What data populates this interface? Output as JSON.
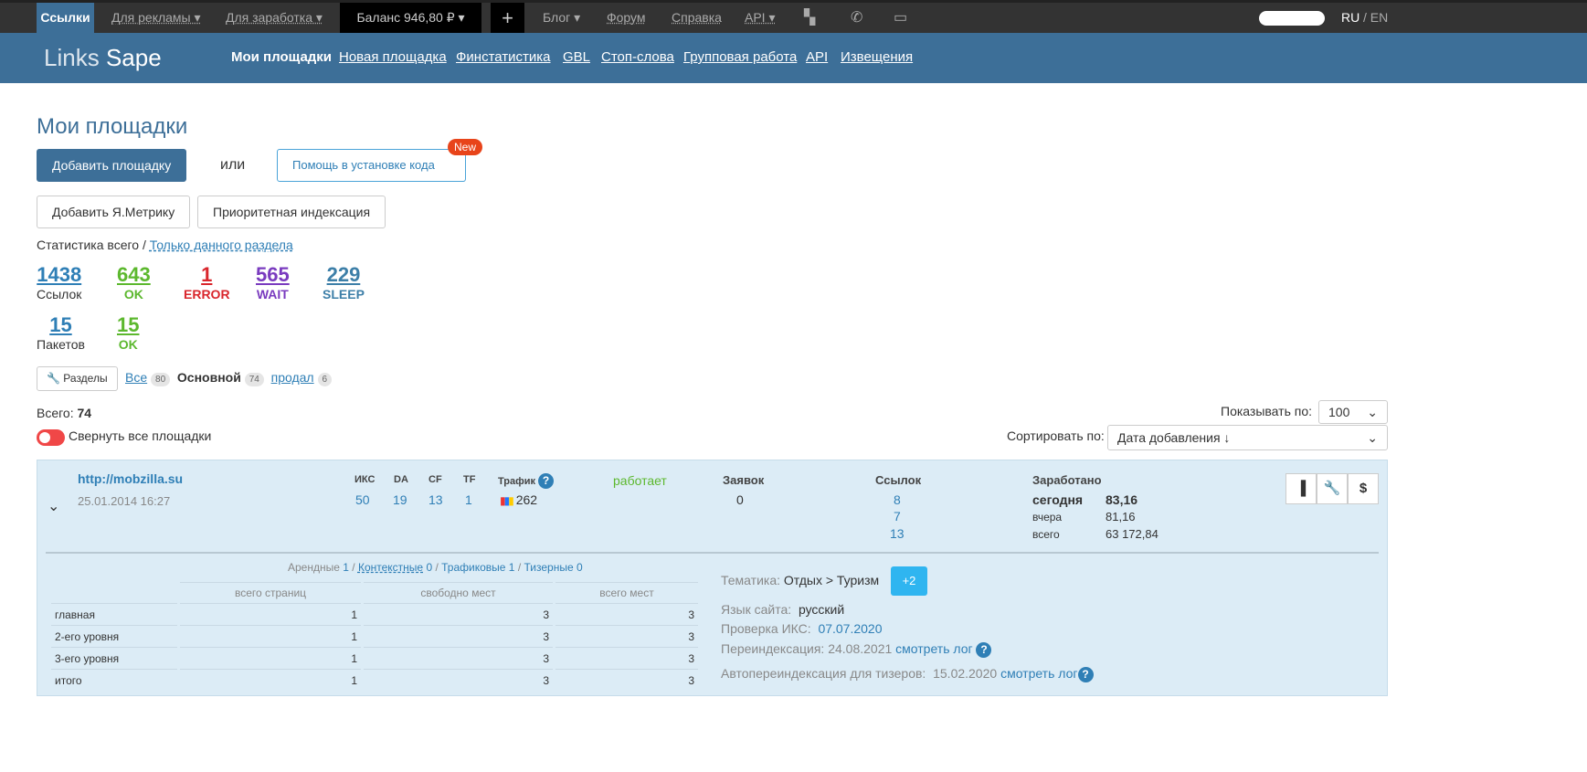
{
  "topbar": {
    "links": "Ссылки",
    "ads": "Для рекламы ▾",
    "earn": "Для заработка ▾",
    "balance": "Баланс 946,80 ₽ ▾",
    "plus": "+",
    "blog": "Блог ▾",
    "forum": "Форум",
    "help": "Справка",
    "api": "API ▾",
    "lang_ru": "RU",
    "lang_en": "/ EN"
  },
  "header": {
    "logo_a": "Links",
    "logo_b": "Sape",
    "nav": [
      "Мои площадки",
      "Новая площадка",
      "Финстатистика",
      "GBL",
      "Стоп-слова",
      "Групповая работа",
      "API",
      "Извещения"
    ]
  },
  "page": {
    "title": "Мои площадки",
    "add": "Добавить площадку",
    "or": "или",
    "help_install": "Помощь в установке кода",
    "new": "New",
    "metrika": "Добавить Я.Метрику",
    "priority": "Приоритетная индексация",
    "stat_all": "Статистика всего /",
    "stat_section": "Только данного раздела"
  },
  "stats": [
    {
      "n": "1438",
      "l": "Ссылок",
      "c": "#2f7fb6"
    },
    {
      "n": "643",
      "l": "OK",
      "c": "#5cb82e"
    },
    {
      "n": "1",
      "l": "ERROR",
      "c": "#d9262c"
    },
    {
      "n": "565",
      "l": "WAIT",
      "c": "#7a3bbf"
    },
    {
      "n": "229",
      "l": "SLEEP",
      "c": "#3d7fa8"
    },
    {
      "n": "15",
      "l": "Пакетов",
      "c": "#2f7fb6"
    },
    {
      "n": "15",
      "l": "OK",
      "c": "#5cb82e"
    }
  ],
  "filters": {
    "sections": "Разделы",
    "all": "Все",
    "all_n": "80",
    "main": "Основной",
    "main_n": "74",
    "sold": "продал",
    "sold_n": "6"
  },
  "list": {
    "total_label": "Всего:",
    "total": "74",
    "collapse": "Свернуть все площадки",
    "show_label": "Показывать по:",
    "show": "100",
    "sort_label": "Сортировать по:",
    "sort": "Дата добавления ↓"
  },
  "site": {
    "url": "http://mobzilla.su",
    "date": "25.01.2014 16:27",
    "metrics_h": [
      "ИКС",
      "DA",
      "CF",
      "TF"
    ],
    "metrics": [
      "50",
      "19",
      "13",
      "1"
    ],
    "traffic_h": "Трафик",
    "traffic": "262",
    "status": "работает",
    "requests_h": "Заявок",
    "requests": "0",
    "links_h": "Ссылок",
    "links": [
      "8",
      "7",
      "13"
    ],
    "earned_h": "Заработано",
    "today_l": "сегодня",
    "today": "83,16",
    "yest_l": "вчера",
    "yest": "81,16",
    "total_l": "всего",
    "total": "63 172,84",
    "types": {
      "rent": "Арендные",
      "rent_n": "1",
      "ctx": "Контекстные",
      "ctx_n": "0",
      "traffic": "Трафиковые",
      "traffic_n": "1",
      "teaser": "Тизерные",
      "teaser_n": "0"
    },
    "table_h": [
      "всего страниц",
      "свободно мест",
      "всего мест"
    ],
    "rows": [
      [
        "главная",
        "1",
        "3",
        "3"
      ],
      [
        "2-его уровня",
        "1",
        "3",
        "3"
      ],
      [
        "3-его уровня",
        "1",
        "3",
        "3"
      ],
      [
        "итого",
        "1",
        "3",
        "3"
      ]
    ],
    "theme_l": "Тематика:",
    "theme": "Отдых > Туризм",
    "theme_more": "+2",
    "lang_l": "Язык сайта:",
    "lang": "русский",
    "iks_l": "Проверка ИКС:",
    "iks": "07.07.2020",
    "reidx_l": "Переиндексация: 24.08.2021",
    "log": "смотреть лог",
    "auto_l": "Автопереиндексация для тизеров:  15.02.2020"
  }
}
